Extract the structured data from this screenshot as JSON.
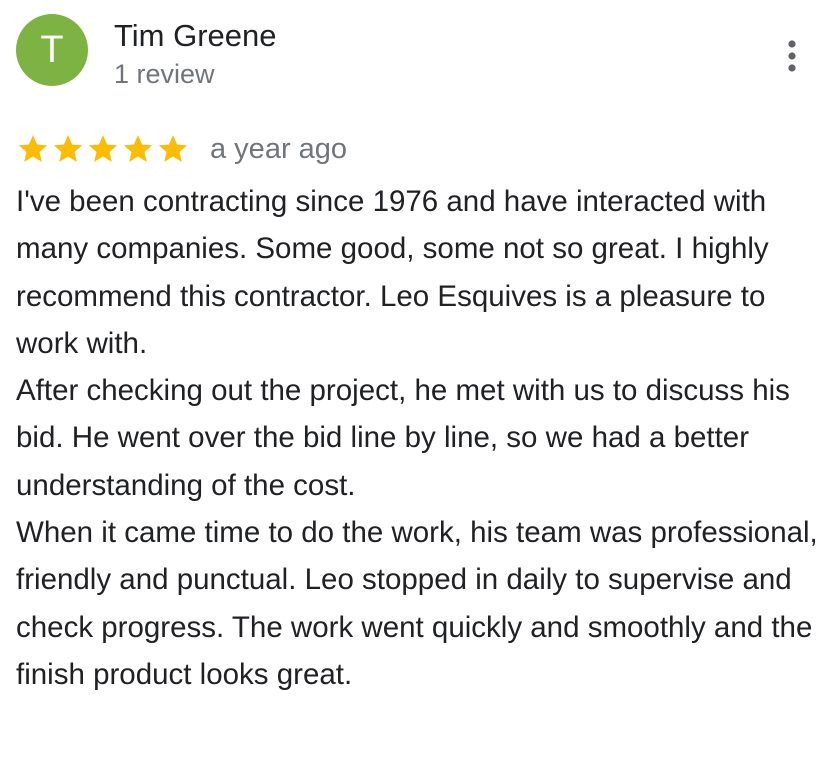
{
  "reviewer": {
    "initial": "T",
    "name": "Tim Greene",
    "review_count": "1 review",
    "avatar_color": "#7cb342"
  },
  "review": {
    "rating": 5,
    "rating_max": 5,
    "star_color": "#fbbc04",
    "date": "a year ago",
    "paragraphs": [
      "I've been contracting since 1976 and have interacted with many companies. Some good, some not so great. I highly recommend this contractor. Leo Esquives is a pleasure to work with.",
      "After checking out the project, he met with us to discuss his bid. He went over the bid line by line, so we had a better understanding of the cost.",
      "When it came time to do the work, his team was professional, friendly and punctual. Leo stopped in daily to supervise and check progress. The work went quickly and smoothly and the finish product looks great."
    ]
  },
  "icons": {
    "star": "star-icon",
    "more": "more-vert-icon"
  }
}
